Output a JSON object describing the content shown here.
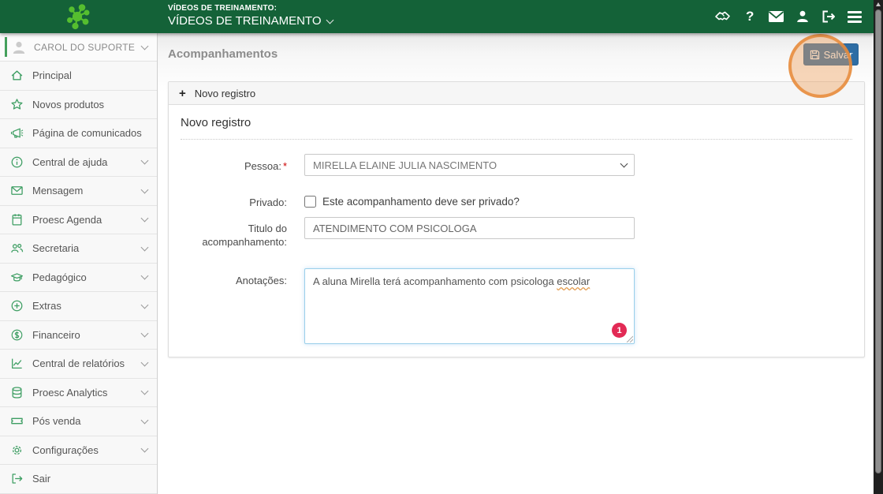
{
  "glyphs": {
    "plus": "+",
    "help": "?"
  },
  "colors": {
    "topbar_green": "#146238",
    "logo_green": "#55be2f",
    "sidebar_icon_green": "#3e9e63",
    "save_button_blue": "#2e6da4",
    "badge_red": "#e22a55",
    "highlight_orange": "#e68a3a"
  },
  "header": {
    "context_label": "VÍDEOS DE TREINAMENTO:",
    "context_title": "VÍDEOS DE TREINAMENTO",
    "icons": [
      "handshake-icon",
      "help-icon",
      "mail-icon",
      "user-icon",
      "logout-icon",
      "menu-icon"
    ]
  },
  "sidebar": {
    "user_name": "CAROL DO SUPORTE",
    "items": [
      {
        "label": "Principal",
        "icon": "home-icon",
        "submenu": false
      },
      {
        "label": "Novos produtos",
        "icon": "star-icon",
        "submenu": false
      },
      {
        "label": "Página de comunicados",
        "icon": "megaphone-icon",
        "submenu": false
      },
      {
        "label": "Central de ajuda",
        "icon": "info-icon",
        "submenu": true
      },
      {
        "label": "Mensagem",
        "icon": "envelope-icon",
        "submenu": true
      },
      {
        "label": "Proesc Agenda",
        "icon": "agenda-icon",
        "submenu": true
      },
      {
        "label": "Secretaria",
        "icon": "people-icon",
        "submenu": true
      },
      {
        "label": "Pedagógico",
        "icon": "graduation-cap-icon",
        "submenu": true
      },
      {
        "label": "Extras",
        "icon": "plus-circle-icon",
        "submenu": true
      },
      {
        "label": "Financeiro",
        "icon": "dollar-icon",
        "submenu": true
      },
      {
        "label": "Central de relatórios",
        "icon": "line-chart-icon",
        "submenu": true
      },
      {
        "label": "Proesc Analytics",
        "icon": "database-icon",
        "submenu": true
      },
      {
        "label": "Pós venda",
        "icon": "ticket-icon",
        "submenu": true
      },
      {
        "label": "Configurações",
        "icon": "gear-icon",
        "submenu": true
      },
      {
        "label": "Sair",
        "icon": "sign-out-icon",
        "submenu": false
      }
    ]
  },
  "main": {
    "page_title": "Acompanhamentos",
    "save_button_label": "Salvar",
    "panel": {
      "header_title": "Novo registro",
      "section_title": "Novo registro",
      "fields": {
        "pessoa": {
          "label": "Pessoa:",
          "required_mark": "*",
          "value": "MIRELLA ELAINE JULIA NASCIMENTO"
        },
        "privado": {
          "label": "Privado:",
          "checkbox_label": "Este acompanhamento deve ser privado?",
          "checked": false
        },
        "titulo": {
          "label": "Titulo do acompanhamento:",
          "value": "ATENDIMENTO COM PSICOLOGA"
        },
        "anotacoes": {
          "label": "Anotações:",
          "value_before": "A aluna Mirella terá acompanhamento com psicologa ",
          "value_misspelled": "escolar",
          "badge_count": "1"
        }
      }
    }
  }
}
